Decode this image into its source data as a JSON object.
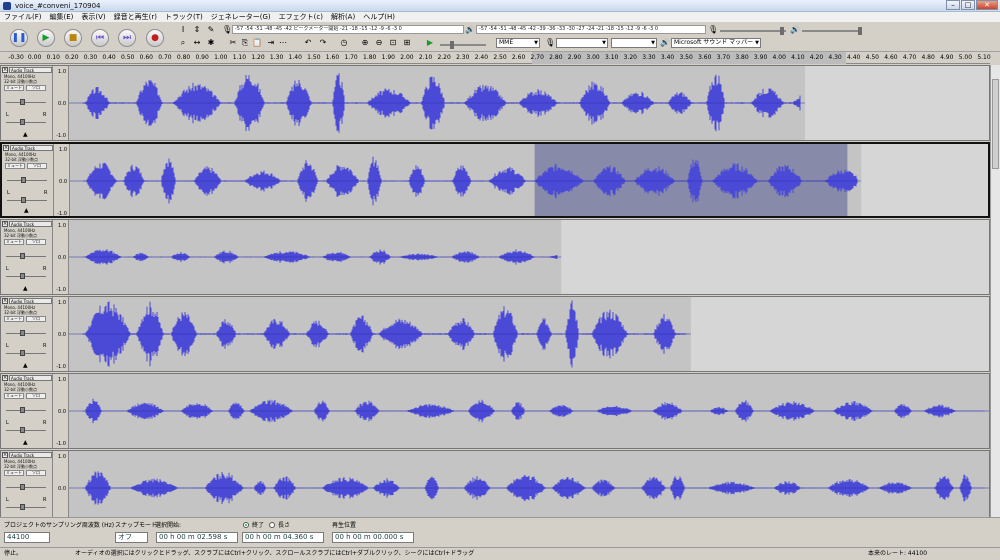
{
  "window": {
    "title": "voice_#conveni_170904",
    "min": "–",
    "max": "□",
    "close": "✕"
  },
  "menu": [
    "ファイル(F)",
    "編集(E)",
    "表示(V)",
    "録音と再生(r)",
    "トラック(T)",
    "ジェネレーター(G)",
    "エフェクト(c)",
    "解析(A)",
    "ヘルプ(H)"
  ],
  "meters": {
    "record": "-57 -54 -51 -48 -45 -42 ピークメーター開始 -21 -18 -15 -12 -9 -6 -3 0",
    "play": "-57 -54 -51 -48 -45 -42 -39 -36 -33 -30 -27 -24 -21 -18 -15 -12 -9 -6 -3 0"
  },
  "device": {
    "host": "MME",
    "output": "Microsoft サウンド マッパー"
  },
  "ruler": {
    "ticks": [
      "-0.30",
      "0.00",
      "0.10",
      "0.20",
      "0.30",
      "0.40",
      "0.50",
      "0.60",
      "0.70",
      "0.80",
      "0.90",
      "1.00",
      "1.10",
      "1.20",
      "1.30",
      "1.40",
      "1.50",
      "1.60",
      "1.70",
      "1.80",
      "1.90",
      "2.00",
      "2.10",
      "2.20",
      "2.30",
      "2.40",
      "2.50",
      "2.60",
      "2.70",
      "2.80",
      "2.90",
      "3.00",
      "3.10",
      "3.20",
      "3.30",
      "3.40",
      "3.50",
      "3.60",
      "3.70",
      "3.80",
      "3.90",
      "4.00",
      "4.10",
      "4.20",
      "4.30",
      "4.40",
      "4.50",
      "4.60",
      "4.70",
      "4.80",
      "4.90",
      "5.00",
      "5.10"
    ]
  },
  "tracks": [
    {
      "name": "Audio Track",
      "info1": "Mono, 44100Hz",
      "info2": "32-bit 浮動小数点",
      "mute": "ミュート",
      "solo": "ソロ",
      "L": "L",
      "R": "R",
      "scale_top": "1.0",
      "scale_mid": "0.0",
      "scale_bot": "-1.0",
      "end": 0.8,
      "amp": 0.9,
      "seed": 3,
      "selected": false,
      "selStart": null,
      "selEnd": null
    },
    {
      "name": "Audio Track",
      "info1": "Mono, 44100Hz",
      "info2": "32-bit 浮動小数点",
      "mute": "ミュート",
      "solo": "ソロ",
      "L": "L",
      "R": "R",
      "scale_top": "1.0",
      "scale_mid": "0.0",
      "scale_bot": "-1.0",
      "end": 0.86,
      "amp": 0.75,
      "seed": 7,
      "selected": true,
      "selStart": 0.505,
      "selEnd": 0.845
    },
    {
      "name": "Audio Track",
      "info1": "Mono, 44100Hz",
      "info2": "32-bit 浮動小数点",
      "mute": "ミュート",
      "solo": "ソロ",
      "L": "L",
      "R": "R",
      "scale_top": "1.0",
      "scale_mid": "0.0",
      "scale_bot": "-1.0",
      "end": 0.535,
      "amp": 0.25,
      "seed": 11,
      "selected": false,
      "selStart": null,
      "selEnd": null
    },
    {
      "name": "Audio Track",
      "info1": "Mono, 44100Hz",
      "info2": "32-bit 浮動小数点",
      "mute": "ミュート",
      "solo": "ソロ",
      "L": "L",
      "R": "R",
      "scale_top": "1.0",
      "scale_mid": "0.0",
      "scale_bot": "-1.0",
      "end": 0.676,
      "amp": 0.95,
      "seed": 17,
      "selected": false,
      "selStart": null,
      "selEnd": null
    },
    {
      "name": "Audio Track",
      "info1": "Mono, 44100Hz",
      "info2": "32-bit 浮動小数点",
      "mute": "ミュート",
      "solo": "ソロ",
      "L": "L",
      "R": "R",
      "scale_top": "1.0",
      "scale_mid": "0.0",
      "scale_bot": "-1.0",
      "end": 1.0,
      "amp": 0.35,
      "seed": 23,
      "selected": false,
      "selStart": null,
      "selEnd": null
    },
    {
      "name": "Audio Track",
      "info1": "Mono, 44100Hz",
      "info2": "32-bit 浮動小数点",
      "mute": "ミュート",
      "solo": "ソロ",
      "L": "L",
      "R": "R",
      "scale_top": "1.0",
      "scale_mid": "0.0",
      "scale_bot": "-1.0",
      "end": 1.0,
      "amp": 0.5,
      "seed": 29,
      "selected": false,
      "selStart": null,
      "selEnd": null
    }
  ],
  "selection": {
    "rate_label": "プロジェクトのサンプリング周波数 (Hz)",
    "rate": "44100",
    "snap_label": "スナップモード",
    "snap": "オフ",
    "start_label": "選択開始:",
    "start": "00 h 00 m 02.598 s",
    "end_radio": "終了",
    "len_radio": "長さ",
    "end": "00 h 00 m 04.360 s",
    "pos_label": "再生位置",
    "pos": "00 h 00 m 00.000 s"
  },
  "status": {
    "left": "停止。",
    "hint": "オーディオの選択にはクリックとドラッグ、スクラブにはCtrl+クリック、スクロールスクラブにはCtrl+ダブルクリック、シークにはCtrl+ドラッグ",
    "rate": "本来のレート: 44100"
  },
  "colors": {
    "wave": "#4a4ad6",
    "waveDark": "#2b2bb0",
    "bg": "#d6d6d6",
    "selectedBg": "#878aa8",
    "empty": "#d6d6d6"
  }
}
